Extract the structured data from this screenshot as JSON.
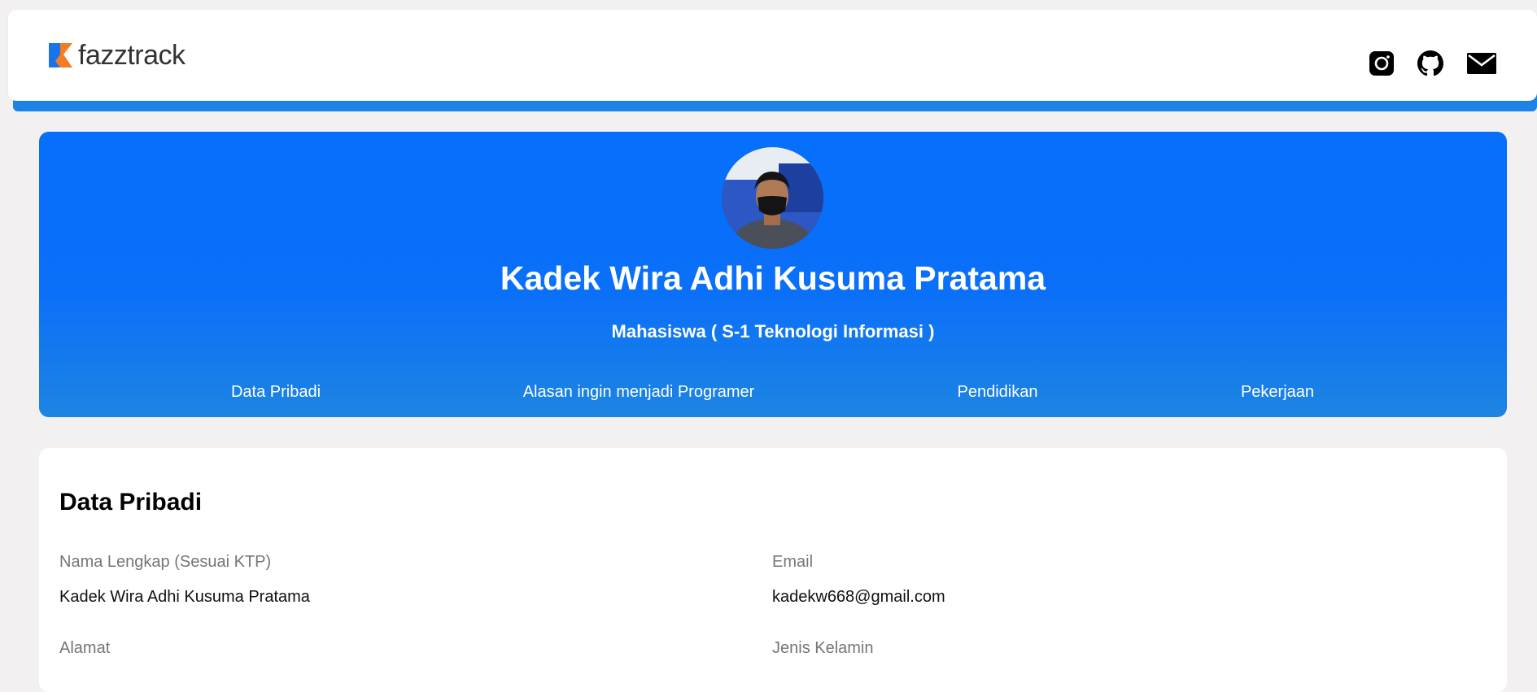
{
  "brand": {
    "name": "fazztrack",
    "accent": "#0a6ff9",
    "logo_orange": "#f57c20"
  },
  "social": [
    {
      "name": "instagram-icon"
    },
    {
      "name": "github-icon"
    },
    {
      "name": "mail-icon"
    }
  ],
  "hero": {
    "name": "Kadek Wira Adhi Kusuma Pratama",
    "role": "Mahasiswa ( S-1 Teknologi Informasi )",
    "nav": [
      "Data Pribadi",
      "Alasan ingin menjadi Programer",
      "Pendidikan",
      "Pekerjaan"
    ]
  },
  "data_pribadi": {
    "title": "Data Pribadi",
    "fields": [
      {
        "label": "Nama Lengkap (Sesuai KTP)",
        "value": "Kadek Wira Adhi Kusuma Pratama"
      },
      {
        "label": "Email",
        "value": "kadekw668@gmail.com"
      },
      {
        "label": "Alamat",
        "value": ""
      },
      {
        "label": "Jenis Kelamin",
        "value": ""
      }
    ]
  }
}
